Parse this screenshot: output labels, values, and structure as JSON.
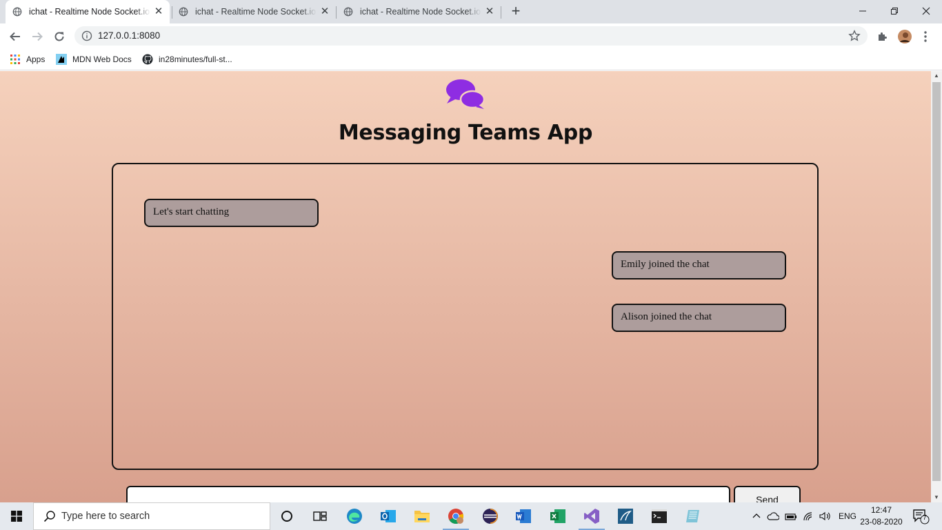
{
  "browser": {
    "tabs": [
      {
        "title": "ichat - Realtime Node Socket.io Chat",
        "active": true
      },
      {
        "title": "ichat - Realtime Node Socket.io Chat",
        "active": false
      },
      {
        "title": "ichat - Realtime Node Socket.io Chat",
        "active": false
      }
    ],
    "new_tab_label": "+",
    "url": "127.0.0.1:8080",
    "bookmarks": [
      {
        "label": "Apps",
        "icon": "apps-grid-icon"
      },
      {
        "label": "MDN Web Docs",
        "icon": "mdn-icon"
      },
      {
        "label": "in28minutes/full-st...",
        "icon": "github-icon"
      }
    ]
  },
  "app": {
    "title": "Messaging Teams App",
    "logo_icon": "chat-bubbles-icon",
    "logo_color": "#8e2de2",
    "messages": [
      {
        "text": "Let's start chatting",
        "side": "left"
      },
      {
        "text": "Emily joined the chat",
        "side": "right"
      },
      {
        "text": "Alison joined the chat",
        "side": "right"
      }
    ],
    "message_input_value": "",
    "send_label": "Send"
  },
  "taskbar": {
    "search_placeholder": "Type here to search",
    "apps": [
      "cortana-icon",
      "task-view-icon",
      "edge-icon",
      "outlook-icon",
      "file-explorer-icon",
      "chrome-icon",
      "eclipse-icon",
      "word-icon",
      "excel-icon",
      "visual-studio-icon",
      "mysql-workbench-icon",
      "terminal-icon",
      "notepad-icon"
    ],
    "language": "ENG",
    "time": "12:47",
    "date": "23-08-2020",
    "notification_count": "7"
  }
}
